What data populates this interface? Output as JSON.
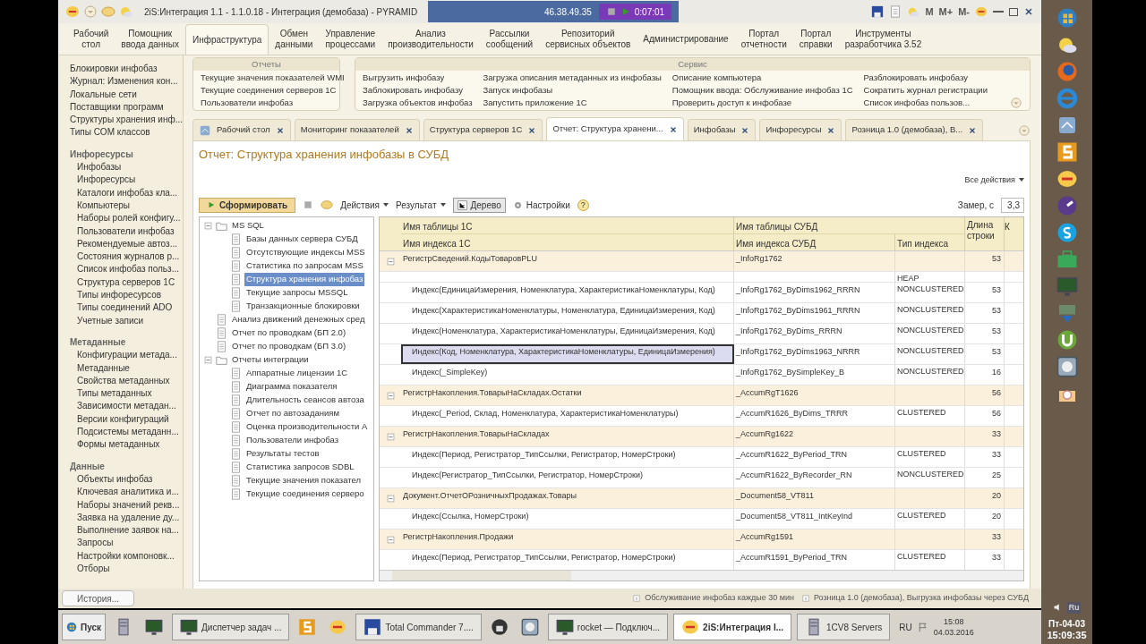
{
  "window": {
    "title": "2iS:Интеграция 1.1 - 1.1.0.18 - Интеграция (демобаза) - PYRAMID",
    "toolbar_texts": [
      "M",
      "M+",
      "M-"
    ]
  },
  "recorder": {
    "address": "46.38.49.35",
    "time": "0:07:01"
  },
  "sections": [
    {
      "label": "Рабочий\nстол",
      "selected": false
    },
    {
      "label": "Помощник\nввода данных",
      "selected": false
    },
    {
      "label": "Инфраструктура",
      "selected": true
    },
    {
      "label": "Обмен\nданными",
      "selected": false
    },
    {
      "label": "Управление\nпроцессами",
      "selected": false
    },
    {
      "label": "Анализ\nпроизводительности",
      "selected": false
    },
    {
      "label": "Рассылки\nсообщений",
      "selected": false
    },
    {
      "label": "Репозиторий\nсервисных объектов",
      "selected": false
    },
    {
      "label": "Администрирование",
      "selected": false
    },
    {
      "label": "Портал\nотчетности",
      "selected": false
    },
    {
      "label": "Портал\nсправки",
      "selected": false
    },
    {
      "label": "Инструменты\nразработчика 3.52",
      "selected": false
    }
  ],
  "nav": [
    {
      "items": [
        "Блокировки инфобаз",
        "Журнал: Изменения кон...",
        "Локальные сети",
        "Поставщики программ",
        "Структуры хранения инф...",
        "Типы COM классов"
      ]
    },
    {
      "header": "Инфоресурсы",
      "items": [
        "Инфобазы",
        "Инфоресурсы",
        "Каталоги инфобаз кла...",
        "Компьютеры",
        "Наборы ролей конфигу...",
        "Пользователи инфобаз",
        "Рекомендуемые автоз...",
        "Состояния журналов р...",
        "Список инфобаз польз...",
        "Структура серверов 1С",
        "Типы инфоресурсов",
        "Типы соединений ADO",
        "Учетные записи"
      ]
    },
    {
      "header": "Метаданные",
      "items": [
        "Конфигурации метада...",
        "Метаданные",
        "Свойства метаданных",
        "Типы метаданных",
        "Зависимости метадан...",
        "Версии конфигураций",
        "Подсистемы метаданн...",
        "Формы метаданных"
      ]
    },
    {
      "header": "Данные",
      "items": [
        "Объекты инфобаз",
        "Ключевая аналитика и...",
        "Наборы значений рекв...",
        "Заявка на удаление ду...",
        "Выполнение заявок на...",
        "Запросы",
        "Настройки компоновк...",
        "Отборы"
      ]
    }
  ],
  "command_groups": [
    {
      "title": "Отчеты",
      "columns": [
        [
          "Текущие значения показателей WMI",
          "Текущие соединения серверов 1С",
          "Пользователи инфобаз"
        ]
      ]
    },
    {
      "title": "Сервис",
      "columns": [
        [
          "Выгрузить инфобазу",
          "Заблокировать инфобазу",
          "Загрузка объектов инфобаз"
        ],
        [
          "Загрузка описания метаданных из инфобазы",
          "Запуск инфобазы",
          "Запустить приложение 1С"
        ],
        [
          "Описание компьютера",
          "Помощник ввода: Обслуживание инфобаз 1С",
          "Проверить доступ к инфобазе"
        ],
        [
          "Разблокировать инфобазу",
          "Сократить журнал регистрации",
          "Список инфобаз пользов..."
        ]
      ]
    }
  ],
  "tabs": [
    {
      "label": "Рабочий стол",
      "selected": false
    },
    {
      "label": "Мониторинг показателей",
      "selected": false
    },
    {
      "label": "Структура серверов 1С",
      "selected": false
    },
    {
      "label": "Отчет: Структура хранени...",
      "selected": true
    },
    {
      "label": "Инфобазы",
      "selected": false
    },
    {
      "label": "Инфоресурсы",
      "selected": false
    },
    {
      "label": "Розница 1.0 (демобаза), В...",
      "selected": false
    }
  ],
  "form": {
    "title": "Отчет: Структура хранения инфобазы в СУБД",
    "all_actions": "Все действия",
    "generate": "Сформировать",
    "actions": "Действия",
    "result": "Результат",
    "tree": "Дерево",
    "settings": "Настройки",
    "help": "?",
    "measure_label": "Замер, с",
    "measure_value": "3,3"
  },
  "tree": [
    {
      "label": "MS SQL",
      "kind": "folder",
      "expanded": true,
      "selected": false,
      "children": [
        {
          "label": "Базы данных сервера СУБД",
          "kind": "report",
          "selected": false
        },
        {
          "label": "Отсутствующие индексы MSS",
          "kind": "report",
          "selected": false
        },
        {
          "label": "Статистика по запросам MSS",
          "kind": "report",
          "selected": false
        },
        {
          "label": "Структура хранения инфобаз",
          "kind": "report",
          "selected": true
        },
        {
          "label": "Текущие запросы MSSQL",
          "kind": "report",
          "selected": false
        },
        {
          "label": "Транзакционные блокировки",
          "kind": "report",
          "selected": false
        }
      ]
    },
    {
      "label": "Анализ движений денежных сред",
      "kind": "report",
      "selected": false
    },
    {
      "label": "Отчет по проводкам (БП 2.0)",
      "kind": "report",
      "selected": false
    },
    {
      "label": "Отчет по проводкам (БП 3.0)",
      "kind": "report",
      "selected": false
    },
    {
      "label": "Отчеты интеграции",
      "kind": "folder",
      "expanded": true,
      "selected": false,
      "children": [
        {
          "label": "Аппаратные лицензии 1С",
          "kind": "report",
          "selected": false
        },
        {
          "label": "Диаграмма показателя",
          "kind": "report",
          "selected": false
        },
        {
          "label": "Длительность сеансов автоза",
          "kind": "report",
          "selected": false
        },
        {
          "label": "Отчет по автозаданиям",
          "kind": "report",
          "selected": false
        },
        {
          "label": "Оценка производительности А",
          "kind": "report",
          "selected": false
        },
        {
          "label": "Пользователи инфобаз",
          "kind": "report",
          "selected": false
        },
        {
          "label": "Результаты тестов",
          "kind": "report",
          "selected": false
        },
        {
          "label": "Статистика запросов SDBL",
          "kind": "report",
          "selected": false
        },
        {
          "label": "Текущие значения показател",
          "kind": "report",
          "selected": false
        },
        {
          "label": "Текущие соединения серверо",
          "kind": "report",
          "selected": false
        }
      ]
    }
  ],
  "table": {
    "header_top": [
      "Имя таблицы 1С",
      "Имя таблицы СУБД",
      "Длина строки",
      "К"
    ],
    "header_bottom": [
      "Имя индекса 1С",
      "Имя индекса СУБД",
      "Тип индекса"
    ],
    "rows": [
      {
        "kind": "group",
        "expanded": true,
        "name": "РегистрСведений.КодыТоваровPLU",
        "db_name": "_InfoRg1762",
        "length": "53",
        "selected": false
      },
      {
        "kind": "index",
        "index_type": "HEAP",
        "selected": false
      },
      {
        "kind": "index",
        "name": "Индекс(ЕдиницаИзмерения, Номенклатура, ХарактеристикаНоменклатуры, Код)",
        "db_name": "_InfoRg1762_ByDims1962_RRRN",
        "index_type": "NONCLUSTERED",
        "length": "53",
        "selected": false
      },
      {
        "kind": "index",
        "name": "Индекс(ХарактеристикаНоменклатуры, Номенклатура, ЕдиницаИзмерения, Код)",
        "db_name": "_InfoRg1762_ByDims1961_RRRN",
        "index_type": "NONCLUSTERED",
        "length": "53",
        "selected": false
      },
      {
        "kind": "index",
        "name": "Индекс(Номенклатура, ХарактеристикаНоменклатуры, ЕдиницаИзмерения, Код)",
        "db_name": "_InfoRg1762_ByDims_RRRN",
        "index_type": "NONCLUSTERED",
        "length": "53",
        "selected": false
      },
      {
        "kind": "index",
        "name": "Индекс(Код, Номенклатура, ХарактеристикаНоменклатуры, ЕдиницаИзмерения)",
        "db_name": "_InfoRg1762_ByDims1963_NRRR",
        "index_type": "NONCLUSTERED",
        "length": "53",
        "selected": true
      },
      {
        "kind": "index",
        "name": "Индекс(_SimpleKey)",
        "db_name": "_InfoRg1762_BySimpleKey_B",
        "index_type": "NONCLUSTERED",
        "length": "16",
        "selected": false
      },
      {
        "kind": "group",
        "expanded": true,
        "name": "РегистрНакопления.ТоварыНаСкладах.Остатки",
        "db_name": "_AccumRgT1626",
        "length": "56",
        "selected": false
      },
      {
        "kind": "index",
        "name": "Индекс(_Period, Склад, Номенклатура, ХарактеристикаНоменклатуры)",
        "db_name": "_AccumR1626_ByDims_TRRR",
        "index_type": "CLUSTERED",
        "length": "56",
        "selected": false
      },
      {
        "kind": "group",
        "expanded": true,
        "name": "РегистрНакопления.ТоварыНаСкладах",
        "db_name": "_AccumRg1622",
        "length": "33",
        "selected": false
      },
      {
        "kind": "index",
        "name": "Индекс(Период, Регистратор_ТипСсылки, Регистратор, НомерСтроки)",
        "db_name": "_AccumR1622_ByPeriod_TRN",
        "index_type": "CLUSTERED",
        "length": "33",
        "selected": false
      },
      {
        "kind": "index",
        "name": "Индекс(Регистратор_ТипСсылки, Регистратор, НомерСтроки)",
        "db_name": "_AccumR1622_ByRecorder_RN",
        "index_type": "NONCLUSTERED",
        "length": "25",
        "selected": false
      },
      {
        "kind": "group",
        "expanded": true,
        "name": "Документ.ОтчетОРозничныхПродажах.Товары",
        "db_name": "_Document58_VT811",
        "length": "20",
        "selected": false
      },
      {
        "kind": "index",
        "name": "Индекс(Ссылка, НомерСтроки)",
        "db_name": "_Document58_VT811_IntKeyInd",
        "index_type": "CLUSTERED",
        "length": "20",
        "selected": false
      },
      {
        "kind": "group",
        "expanded": true,
        "name": "РегистрНакопления.Продажи",
        "db_name": "_AccumRg1591",
        "length": "33",
        "selected": false
      },
      {
        "kind": "index",
        "name": "Индекс(Период, Регистратор_ТипСсылки, Регистратор, НомерСтроки)",
        "db_name": "_AccumR1591_ByPeriod_TRN",
        "index_type": "CLUSTERED",
        "length": "33",
        "selected": false
      }
    ]
  },
  "status_bar": {
    "history": "История...",
    "messages": [
      "Обслуживание инфобаз каждые 30 мин",
      "Розница 1.0 (демобаза), Выгрузка инфобазы через СУБД"
    ]
  },
  "taskbar": {
    "start": "Пуск",
    "items": [
      {
        "kind": "server"
      },
      {
        "kind": "monitor"
      },
      {
        "label": "Диспетчер задач ...",
        "kind": "monitor"
      },
      {
        "kind": "s"
      },
      {
        "kind": "onec"
      },
      {
        "label": "Total Commander 7....",
        "kind": "disk"
      },
      {
        "kind": "lock"
      },
      {
        "kind": "t"
      },
      {
        "label": "rocket — Подключ...",
        "kind": "monitor"
      },
      {
        "label": "2iS:Интеграция I...",
        "kind": "onec",
        "selected": true
      },
      {
        "label": "1CV8 Servers",
        "kind": "server"
      }
    ],
    "lang": "RU",
    "time": "15:08",
    "date": "04.03.2016"
  },
  "side_panel": {
    "lang": "Ru",
    "day": "Пт-04-03",
    "clock": "15:09:35"
  }
}
